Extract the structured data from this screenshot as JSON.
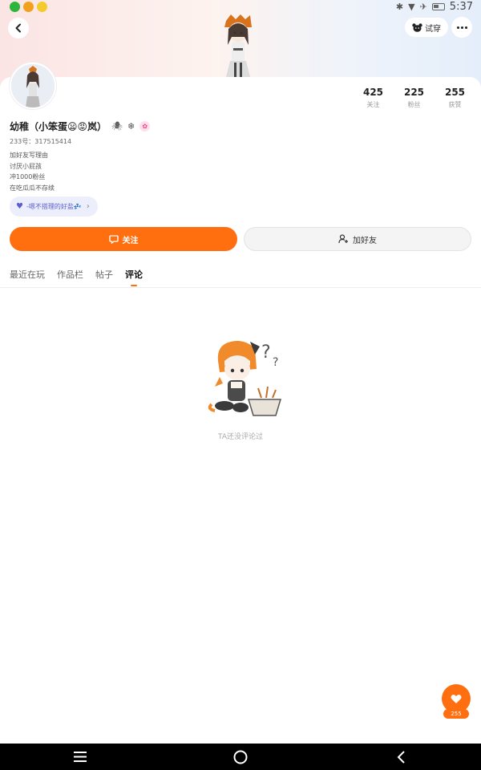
{
  "status_bar": {
    "time": "5:37",
    "left_icons": [
      "green-app-icon",
      "orange-app-icon",
      "yellow-app-icon"
    ],
    "right_icons": [
      "bluetooth-icon",
      "wifi-icon",
      "airplane-icon",
      "battery-icon"
    ]
  },
  "header": {
    "back_icon": "chevron-left-icon",
    "try_label": "试穿",
    "more_icon": "more-dots-icon"
  },
  "profile": {
    "name": "幼稚（小笨蛋😦😡岚）",
    "uid": "233号：317515414",
    "bio_lines": [
      "加好友写理由",
      "讨厌小屁孩",
      "冲1000粉丝",
      "在吃瓜瓜不存续"
    ],
    "tag_label": "-嗯不搭理的好盐💤",
    "stats": [
      {
        "num": "425",
        "label": "关注"
      },
      {
        "num": "225",
        "label": "粉丝"
      },
      {
        "num": "255",
        "label": "获赞"
      }
    ]
  },
  "actions": {
    "follow_label": "关注",
    "add_friend_label": "加好友"
  },
  "tabs": [
    {
      "label": "最近在玩",
      "active": false
    },
    {
      "label": "作品栏",
      "active": false
    },
    {
      "label": "帖子",
      "active": false
    },
    {
      "label": "评论",
      "active": true
    }
  ],
  "empty_state": {
    "text": "TA还没评论过"
  },
  "floating": {
    "like_count": "255"
  },
  "colors": {
    "accent": "#ff6f0f",
    "tag_bg": "#eceefb",
    "tag_text": "#5a5fd0"
  }
}
